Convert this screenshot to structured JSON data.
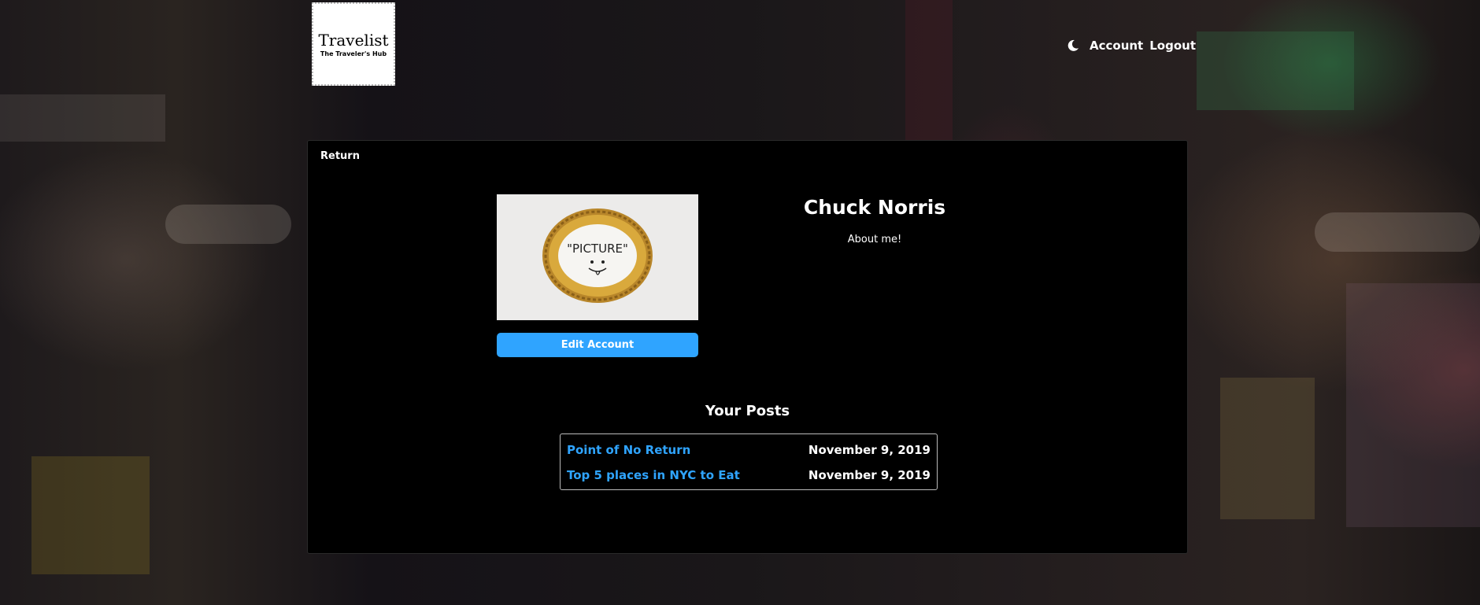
{
  "logo": {
    "title": "Travelist",
    "subtitle": "The Traveler's Hub"
  },
  "nav": {
    "account": "Account",
    "logout": "Logout"
  },
  "profile": {
    "return_label": "Return",
    "name": "Chuck Norris",
    "about": "About me!",
    "picture_text": "\"PICTURE\"",
    "edit_button": "Edit Account"
  },
  "posts": {
    "heading": "Your Posts",
    "items": [
      {
        "title": "Point of No Return",
        "date": "November 9, 2019"
      },
      {
        "title": "Top 5 places in NYC to Eat",
        "date": "November 9, 2019"
      }
    ]
  },
  "colors": {
    "accent": "#2fa4ff",
    "panel": "#000000",
    "text": "#ffffff"
  },
  "icons": {
    "theme_toggle": "moon-icon"
  }
}
